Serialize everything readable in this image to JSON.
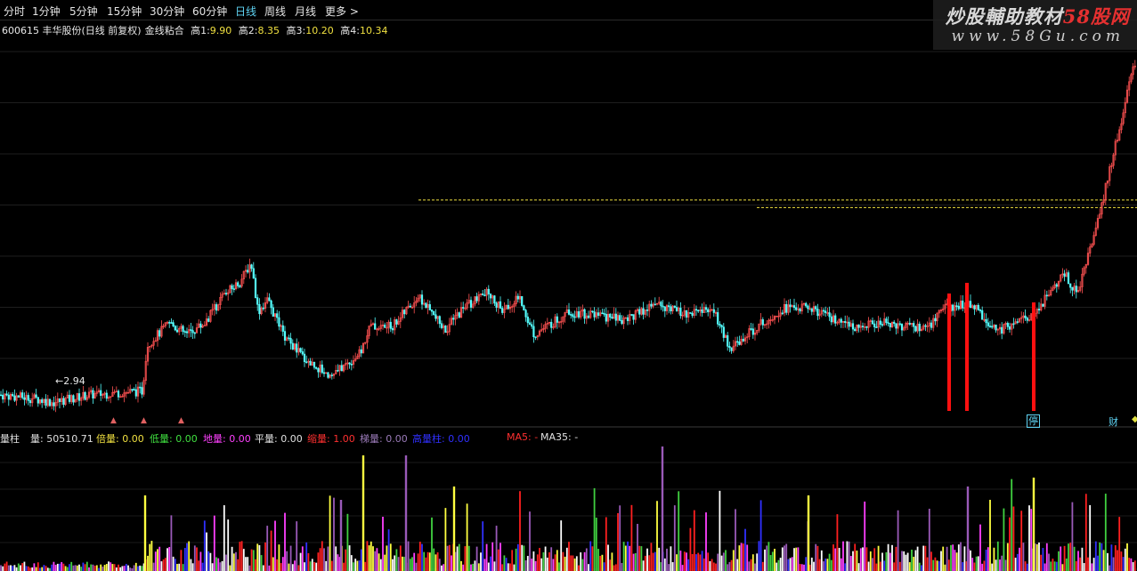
{
  "toolbar": {
    "tabs": [
      {
        "label": "分时",
        "active": false
      },
      {
        "label": "1分钟",
        "active": false
      },
      {
        "label": "5分钟",
        "active": false
      },
      {
        "label": "15分钟",
        "active": false
      },
      {
        "label": "30分钟",
        "active": false
      },
      {
        "label": "60分钟",
        "active": false
      },
      {
        "label": "日线",
        "active": true
      },
      {
        "label": "周线",
        "active": false
      },
      {
        "label": "月线",
        "active": false
      },
      {
        "label": "更多 >",
        "active": false
      }
    ]
  },
  "info": {
    "stock": "600615 丰华股份(日线 前复权)",
    "indicator": "金线粘合",
    "high1_label": "高1:",
    "high1": "9.90",
    "high2_label": "高2:",
    "high2": "8.35",
    "high3_label": "高3:",
    "high3": "10.20",
    "high4_label": "高4:",
    "high4": "10.34"
  },
  "watermark": {
    "title_a": "炒股輔助教材",
    "title_b": "58股网",
    "url": "www.58Gu.com"
  },
  "chart": {
    "low_label": "2.94",
    "markers": {
      "stop": "停",
      "finance": "财"
    },
    "level_lines": [
      {
        "value": 8.35
      },
      {
        "value": 8.15
      }
    ],
    "colors": {
      "up": "#ff5252",
      "down": "#54ffff",
      "level": "#f0e040",
      "signal": "#ff1010"
    }
  },
  "volume_bar": {
    "title": "量柱",
    "items": [
      {
        "label": "量:",
        "value": "50510.71",
        "color": "#e0e0e0"
      },
      {
        "label": "倍量:",
        "value": "0.00",
        "color": "#f0e040"
      },
      {
        "label": "低量:",
        "value": "0.00",
        "color": "#40e040"
      },
      {
        "label": "地量:",
        "value": "0.00",
        "color": "#ff40ff"
      },
      {
        "label": "平量:",
        "value": "0.00",
        "color": "#e0e0e0"
      },
      {
        "label": "缩量:",
        "value": "1.00",
        "color": "#ff3030"
      },
      {
        "label": "梯量:",
        "value": "0.00",
        "color": "#9a7ab8"
      },
      {
        "label": "高量柱:",
        "value": "0.00",
        "color": "#3030ff"
      }
    ],
    "ma5": "MA5: -",
    "ma35": "MA35: -",
    "ma5_color": "#ff3030",
    "ma35_color": "#e0e0e0"
  }
}
